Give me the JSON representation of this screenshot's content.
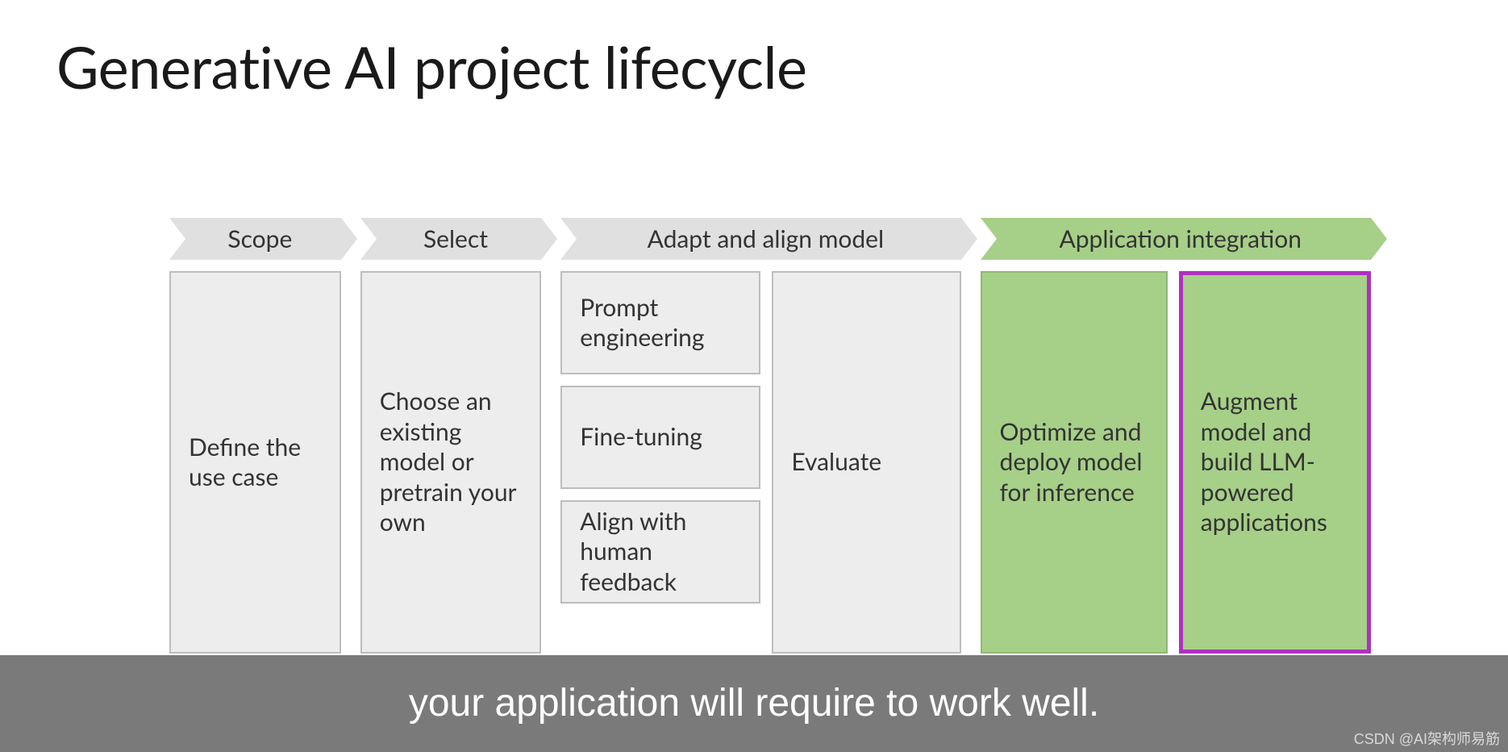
{
  "title": "Generative AI project lifecycle",
  "phases": {
    "scope": {
      "header": "Scope",
      "card": "Define the use case"
    },
    "select": {
      "header": "Select",
      "card": "Choose an existing model or pretrain your own"
    },
    "adapt": {
      "header": "Adapt and align model",
      "left": {
        "prompt": "Prompt engineering",
        "finetune": "Fine-tuning",
        "align": "Align with human feedback"
      },
      "right": "Evaluate"
    },
    "app": {
      "header": "Application integration",
      "left": "Optimize and deploy model for inference",
      "right": "Augment model and build LLM-powered applications"
    }
  },
  "caption": "your application will require to work well.",
  "watermark": "CSDN @AI架构师易筋",
  "colors": {
    "gray_bg": "#ededed",
    "gray_arrow": "#e0e0e0",
    "green": "#a6cf88",
    "highlight_border": "#b030c0",
    "caption_bg": "#7a7a7a"
  }
}
